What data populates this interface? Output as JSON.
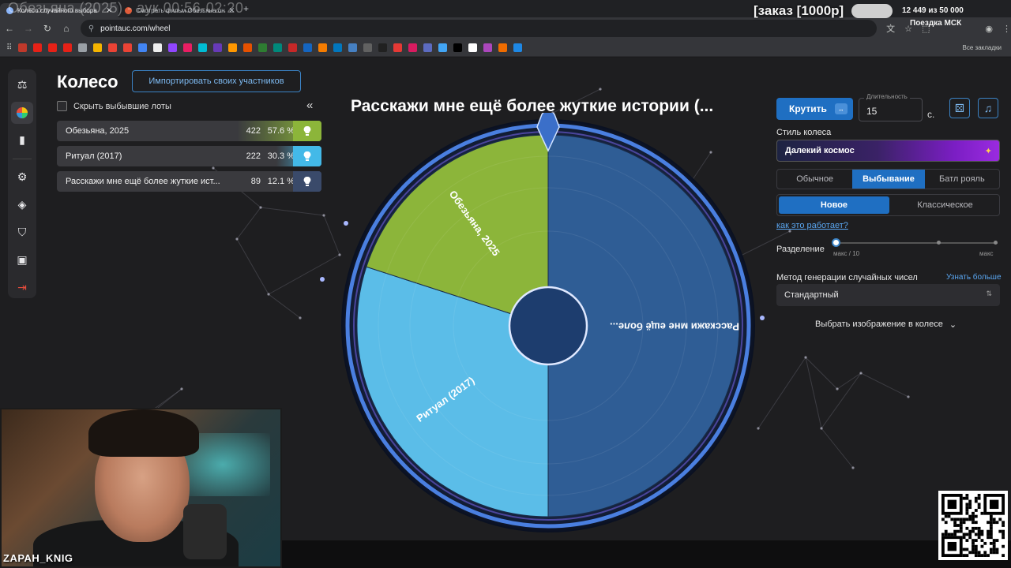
{
  "browser": {
    "tabs": [
      {
        "title": "Колесо случайного выбора",
        "active": true
      },
      {
        "title": "Смотреть фильм Обезьяна он",
        "active": false
      }
    ],
    "overlay_title": "Обезьяна (2025) - аук 00:56-02:20",
    "url": "pointauc.com/wheel",
    "bookmarks_all": "Все закладки"
  },
  "stream_overlay": {
    "order": "[заказ [1000р]",
    "donation_progress": "12 449  из 50 000",
    "trip": "Поездка МСК",
    "streamer_name": "ZAPAH_KNIG"
  },
  "sidebar": {
    "items": [
      {
        "icon": "gavel-icon",
        "active": false
      },
      {
        "icon": "wheel-icon",
        "active": true
      },
      {
        "icon": "stats-icon",
        "active": false
      },
      {
        "icon": "settings-icon",
        "active": false
      },
      {
        "icon": "layers-icon",
        "active": false
      },
      {
        "icon": "shield-icon",
        "active": false
      },
      {
        "icon": "video-icon",
        "active": false
      },
      {
        "icon": "logout-icon",
        "active": false
      }
    ]
  },
  "left_panel": {
    "title": "Колесо",
    "import_button": "Импортировать своих участников",
    "hide_eliminated": "Скрыть выбывшие лоты",
    "lots": [
      {
        "name": "Обезьяна, 2025",
        "amount": "422",
        "percent": "57.6 %",
        "color": "#8cb53a"
      },
      {
        "name": "Ритуал (2017)",
        "amount": "222",
        "percent": "30.3 %",
        "color": "#43b9e8"
      },
      {
        "name": "Расскажи мне ещё более жуткие ист...",
        "amount": "89",
        "percent": "12.1 %",
        "color": "#3a4a6a"
      }
    ]
  },
  "wheel": {
    "title": "Расскажи мне ещё более жуткие истории (...",
    "segments": [
      {
        "label": "Расскажи мне ещё боле...",
        "color": "#2f5d95",
        "share": 0.5
      },
      {
        "label": "Ритуал (2017)",
        "color": "#5bbde8",
        "share": 0.3
      },
      {
        "label": "Обезьяна, 2025",
        "color": "#8cb53a",
        "share": 0.2
      }
    ]
  },
  "right_panel": {
    "spin_button": "Крутить",
    "duration_label": "Длительность",
    "duration_value": "15",
    "duration_unit": "с.",
    "style_label": "Стиль колеса",
    "style_value": "Далекий космос",
    "modes": [
      "Обычное",
      "Выбывание",
      "Батл рояль"
    ],
    "active_mode": 1,
    "variants": [
      "Новое",
      "Классическое"
    ],
    "active_variant": 0,
    "how_it_works": "как это работает?",
    "separation_label": "Разделение",
    "slider_min_label": "макс / 10",
    "slider_max_label": "макс",
    "rng_label": "Метод генерации случайных чисел",
    "rng_more": "Узнать больше",
    "rng_value": "Стандартный",
    "image_pick": "Выбрать изображение в колесе"
  }
}
